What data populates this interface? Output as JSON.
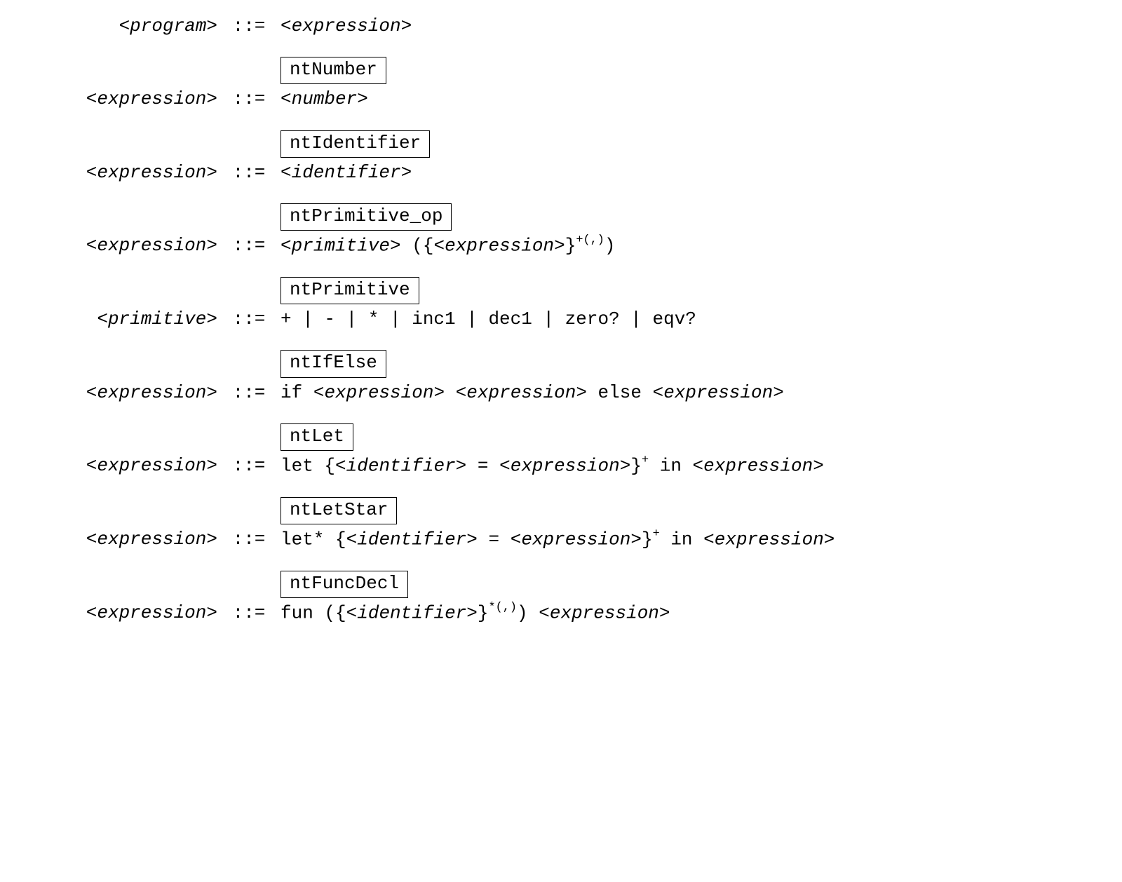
{
  "op": "::=",
  "angle_l": "<",
  "angle_r": ">",
  "rules": [
    {
      "lhs": "program",
      "label": null,
      "rhs_html": "<span class='angle'>&lt;</span><span class='nt'>expression</span><span class='angle'>&gt;</span>",
      "first": true
    },
    {
      "lhs": "expression",
      "label": "ntNumber",
      "rhs_html": "<span class='angle'>&lt;</span><span class='nt'>number</span><span class='angle'>&gt;</span>"
    },
    {
      "lhs": "expression",
      "label": "ntIdentifier",
      "rhs_html": "<span class='angle'>&lt;</span><span class='nt'>identifier</span><span class='angle'>&gt;</span>"
    },
    {
      "lhs": "expression",
      "label": "ntPrimitive_op",
      "rhs_html": "<span class='angle'>&lt;</span><span class='nt'>primitive</span><span class='angle'>&gt;</span> <span class='tt'>(</span>{<span class='angle'>&lt;</span><span class='nt'>expression</span><span class='angle'>&gt;</span>}<span class='sup'>+(,)</span><span class='tt'>)</span>"
    },
    {
      "lhs": "primitive",
      "label": "ntPrimitive",
      "rhs_html": "<span class='tt'>+&nbsp;|&nbsp;-&nbsp;|&nbsp;*&nbsp;|&nbsp;inc1&nbsp;|&nbsp;dec1&nbsp;|&nbsp;zero?&nbsp;|&nbsp;eqv?</span>"
    },
    {
      "lhs": "expression",
      "label": "ntIfElse",
      "rhs_html": "<span class='tt'>if</span> <span class='angle'>&lt;</span><span class='nt'>expression</span><span class='angle'>&gt;</span> <span class='angle'>&lt;</span><span class='nt'>expression</span><span class='angle'>&gt;</span> <span class='tt'>else</span> <span class='angle'>&lt;</span><span class='nt'>expression</span><span class='angle'>&gt;</span>"
    },
    {
      "lhs": "expression",
      "label": "ntLet",
      "rhs_html": "<span class='tt'>let</span> {<span class='angle'>&lt;</span><span class='nt'>identifier</span><span class='angle'>&gt;</span> <span class='tt'>=</span> <span class='angle'>&lt;</span><span class='nt'>expression</span><span class='angle'>&gt;</span>}<span class='sup'>+</span> <span class='tt'>in</span> <span class='angle'>&lt;</span><span class='nt'>expression</span><span class='angle'>&gt;</span>"
    },
    {
      "lhs": "expression",
      "label": "ntLetStar",
      "rhs_html": "<span class='tt'>let*</span> {<span class='angle'>&lt;</span><span class='nt'>identifier</span><span class='angle'>&gt;</span> <span class='tt'>=</span> <span class='angle'>&lt;</span><span class='nt'>expression</span><span class='angle'>&gt;</span>}<span class='sup'>+</span> <span class='tt'>in</span> <span class='angle'>&lt;</span><span class='nt'>expression</span><span class='angle'>&gt;</span>"
    },
    {
      "lhs": "expression",
      "label": "ntFuncDecl",
      "rhs_html": "<span class='tt'>fun</span> <span class='tt'>(</span>{<span class='angle'>&lt;</span><span class='nt'>identifier</span><span class='angle'>&gt;</span>}<span class='sup'>*(,)</span><span class='tt'>)</span> <span class='angle'>&lt;</span><span class='nt'>expression</span><span class='angle'>&gt;</span>"
    }
  ]
}
